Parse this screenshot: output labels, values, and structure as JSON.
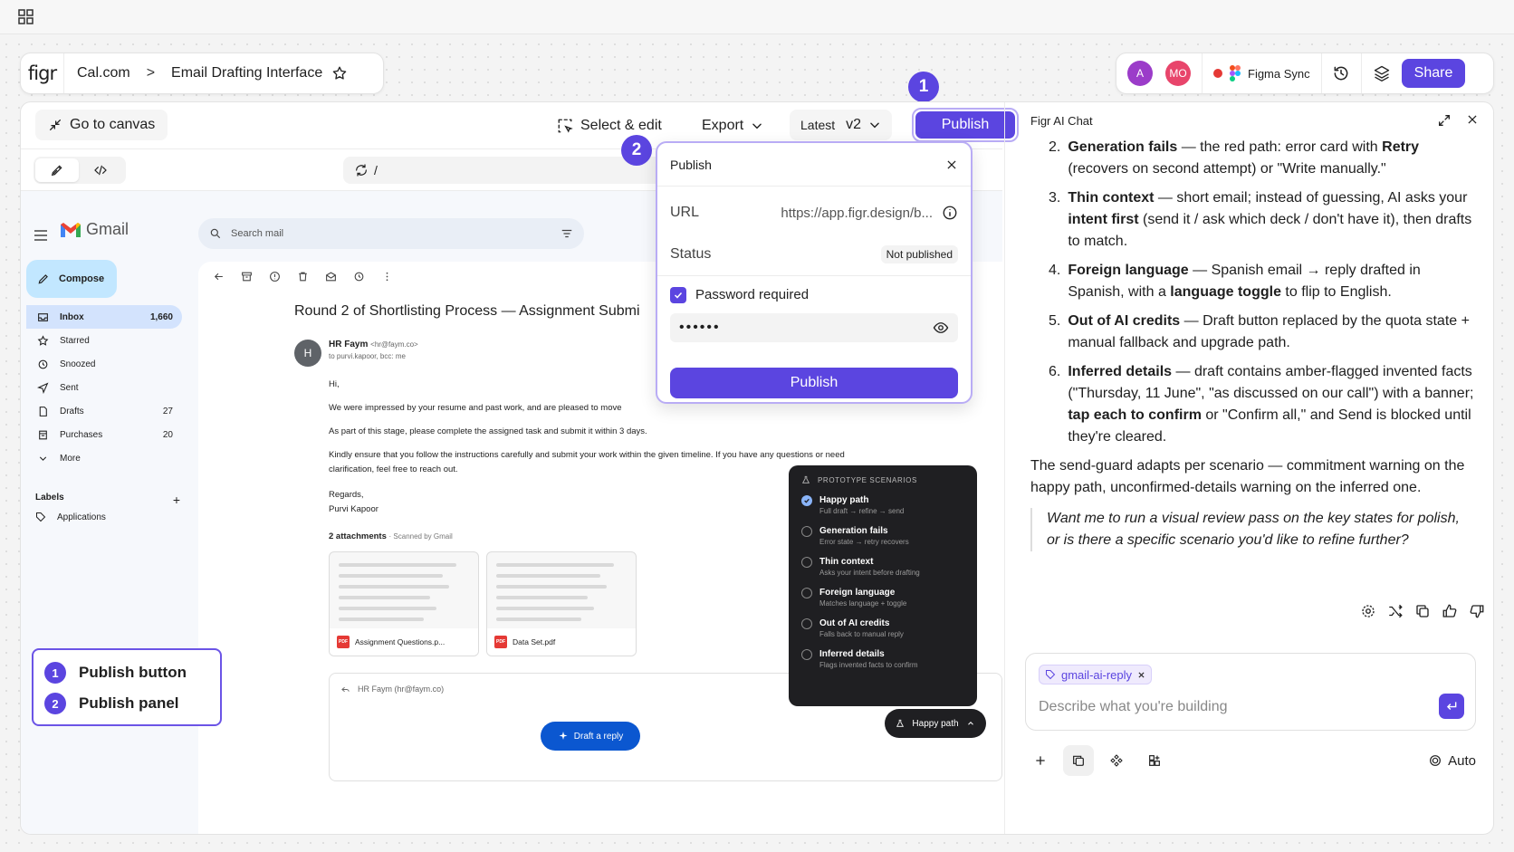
{
  "brand": {
    "logo_text": "figr",
    "accent": "#5b45e0"
  },
  "breadcrumb": {
    "project": "Cal.com",
    "separator": ">",
    "page": "Email Drafting Interface"
  },
  "header_right": {
    "avatars": [
      {
        "initials": "A",
        "color": "#9b3cc9"
      },
      {
        "initials": "MO",
        "color": "#e8456b"
      }
    ],
    "figma_sync_label": "Figma Sync",
    "share_label": "Share"
  },
  "canvas_toolbar": {
    "go_to_canvas": "Go to canvas",
    "select_edit": "Select & edit",
    "export": "Export",
    "version_prefix": "Latest",
    "version": "v2",
    "publish": "Publish",
    "badge_1": "1",
    "badge_2": "2"
  },
  "preview_bar": {
    "path": "/"
  },
  "gmail": {
    "logo_text": "Gmail",
    "search_placeholder": "Search mail",
    "compose": "Compose",
    "nav": [
      {
        "label": "Inbox",
        "count": "1,660",
        "icon": "inbox-icon"
      },
      {
        "label": "Starred",
        "count": "",
        "icon": "star-icon"
      },
      {
        "label": "Snoozed",
        "count": "",
        "icon": "clock-icon"
      },
      {
        "label": "Sent",
        "count": "",
        "icon": "send-icon"
      },
      {
        "label": "Drafts",
        "count": "27",
        "icon": "draft-icon"
      },
      {
        "label": "Purchases",
        "count": "20",
        "icon": "purchases-icon"
      },
      {
        "label": "More",
        "count": "",
        "icon": "chevron-down-icon"
      }
    ],
    "labels_heading": "Labels",
    "labels_add": "+",
    "label_item": "Applications",
    "email": {
      "subject": "Round 2 of Shortlisting Process — Assignment Submi",
      "sender_initial": "H",
      "sender_name": "HR Faym",
      "sender_email": "<hr@faym.co>",
      "to_line": "to purvi.kapoor, bcc: me",
      "greeting": "Hi,",
      "p1": "We were impressed by your resume and past work, and are pleased to move",
      "p2": "As part of this stage, please complete the assigned task and submit it within 3 days.",
      "p3": "Kindly ensure that you follow the instructions carefully and submit your work within the given timeline. If you have any questions or need clarification, feel free to reach out.",
      "sign1": "Regards,",
      "sign2": "Purvi Kapoor",
      "attachments_label": "2 attachments",
      "scanned": "Scanned by Gmail",
      "attachments": [
        "Assignment Questions.p...",
        "Data Set.pdf"
      ],
      "pdf_tag": "PDF",
      "reply_to": "HR Faym (hr@faym.co)",
      "draft_reply": "Draft a reply"
    }
  },
  "scenarios": {
    "heading": "PROTOTYPE SCENARIOS",
    "items": [
      {
        "title": "Happy path",
        "sub": "Full draft → refine → send",
        "selected": true
      },
      {
        "title": "Generation fails",
        "sub": "Error state → retry recovers",
        "selected": false
      },
      {
        "title": "Thin context",
        "sub": "Asks your intent before drafting",
        "selected": false
      },
      {
        "title": "Foreign language",
        "sub": "Matches language + toggle",
        "selected": false
      },
      {
        "title": "Out of AI credits",
        "sub": "Falls back to manual reply",
        "selected": false
      },
      {
        "title": "Inferred details",
        "sub": "Flags invented facts to confirm",
        "selected": false
      }
    ],
    "current": "Happy path"
  },
  "legend": {
    "items": [
      {
        "num": "1",
        "label": "Publish button"
      },
      {
        "num": "2",
        "label": "Publish panel"
      }
    ]
  },
  "publish_panel": {
    "title": "Publish",
    "url_label": "URL",
    "url_value": "https://app.figr.design/b...",
    "status_label": "Status",
    "status_value": "Not published",
    "password_label": "Password required",
    "password_value": "••••••",
    "publish_button": "Publish"
  },
  "chat": {
    "title": "Figr AI Chat",
    "items": [
      {
        "n": "2.",
        "bold": "Generation fails",
        "rest": " — the red path: error card with ",
        "b2": "Retry",
        "rest2": " (recovers on second attempt) or \"Write manually.\""
      },
      {
        "n": "3.",
        "bold": "Thin context",
        "rest": " — short email; instead of guessing, AI asks your ",
        "b2": "intent first",
        "rest2": " (send it / ask which deck / don't have it), then drafts to match."
      },
      {
        "n": "4.",
        "bold": "Foreign language",
        "rest": " — Spanish email → reply drafted in Spanish, with a ",
        "b2": "language toggle",
        "rest2": " to flip to English."
      },
      {
        "n": "5.",
        "bold": "Out of AI credits",
        "rest": " — Draft button replaced by the quota state + manual fallback and upgrade path.",
        "b2": "",
        "rest2": ""
      },
      {
        "n": "6.",
        "bold": "Inferred details",
        "rest": " — draft contains amber-flagged invented facts (\"Thursday, 11 June\", \"as discussed on our call\") with a banner; ",
        "b2": "tap each to confirm",
        "rest2": " or \"Confirm all,\" and Send is blocked until they're cleared."
      }
    ],
    "paragraph": "The send-guard adapts per scenario — commitment warning on the happy path, unconfirmed-details warning on the inferred one.",
    "question": "Want me to run a visual review pass on the key states for polish, or is there a specific scenario you'd like to refine further?",
    "chip": "gmail-ai-reply",
    "input_placeholder": "Describe what you're building",
    "auto_label": "Auto"
  }
}
